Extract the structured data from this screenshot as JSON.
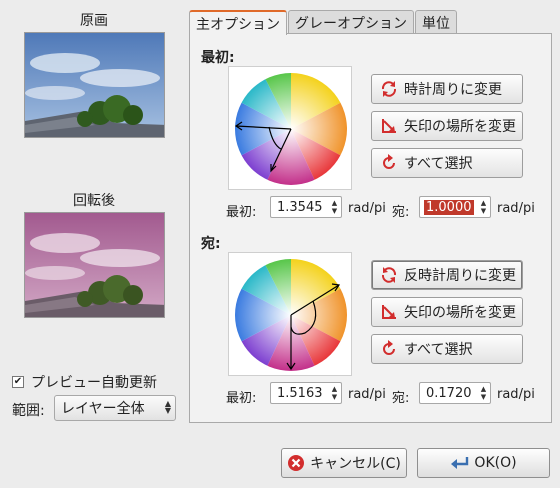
{
  "previews": {
    "original_label": "原画",
    "rotated_label": "回転後"
  },
  "options": {
    "auto_update_label": "プレビュー自動更新",
    "auto_update_checked": true,
    "scope_label": "範囲:",
    "scope_value": "レイヤー全体"
  },
  "tabs": [
    "主オプション",
    "グレーオプション",
    "単位"
  ],
  "from_section": {
    "label": "最初:",
    "buttons": [
      "時計周りに変更",
      "矢印の場所を変更",
      "すべて選択"
    ],
    "start_label": "最初:",
    "start_value": "1.3545",
    "start_unit": "rad/pi",
    "end_label": "宛:",
    "end_value": "1.0000",
    "end_unit": "rad/pi"
  },
  "to_section": {
    "label": "宛:",
    "buttons": [
      "反時計周りに変更",
      "矢印の場所を変更",
      "すべて選択"
    ],
    "start_label": "最初:",
    "start_value": "1.5163",
    "start_unit": "rad/pi",
    "end_label": "宛:",
    "end_value": "0.1720",
    "end_unit": "rad/pi"
  },
  "dialog": {
    "cancel_label": "キャンセル(C)",
    "ok_label": "OK(O)"
  },
  "icons": {
    "rotate": "rotate-arrows-icon",
    "move_arrow": "move-arrow-icon",
    "select_all": "select-all-icon",
    "cancel": "cancel-icon",
    "ok": "ok-icon"
  },
  "colors": {
    "tab_accent": "#e06a2a",
    "selected_value_bg": "#c0392b",
    "cancel_icon": "#d22d2d",
    "ok_icon": "#3a6fb0"
  }
}
